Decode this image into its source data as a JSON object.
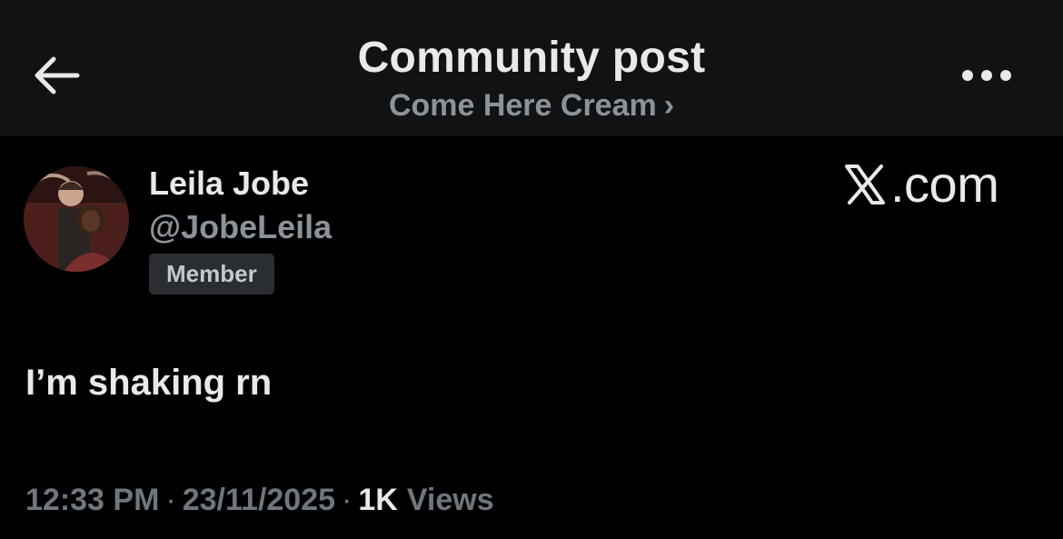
{
  "header": {
    "title": "Community post",
    "community_name": "Come Here Cream",
    "community_chevron": "›"
  },
  "icons": {
    "back": "back-arrow-icon",
    "more": "more-horizontal-icon",
    "x_logo": "x-logo-icon"
  },
  "post": {
    "author": {
      "display_name": "Leila Jobe",
      "handle": "@JobeLeila",
      "role_badge": "Member"
    },
    "watermark": ".com",
    "text": "I’m shaking rn",
    "meta": {
      "time": "12:33 PM",
      "separator": "·",
      "date": "23/11/2025",
      "views_count": "1K",
      "views_label": "Views"
    }
  },
  "colors": {
    "background": "#000000",
    "header_background": "#111213",
    "primary_text": "#e7e9ea",
    "secondary_text": "#8b9299",
    "meta_text": "#6f767d",
    "badge_background": "#2a2d31"
  }
}
